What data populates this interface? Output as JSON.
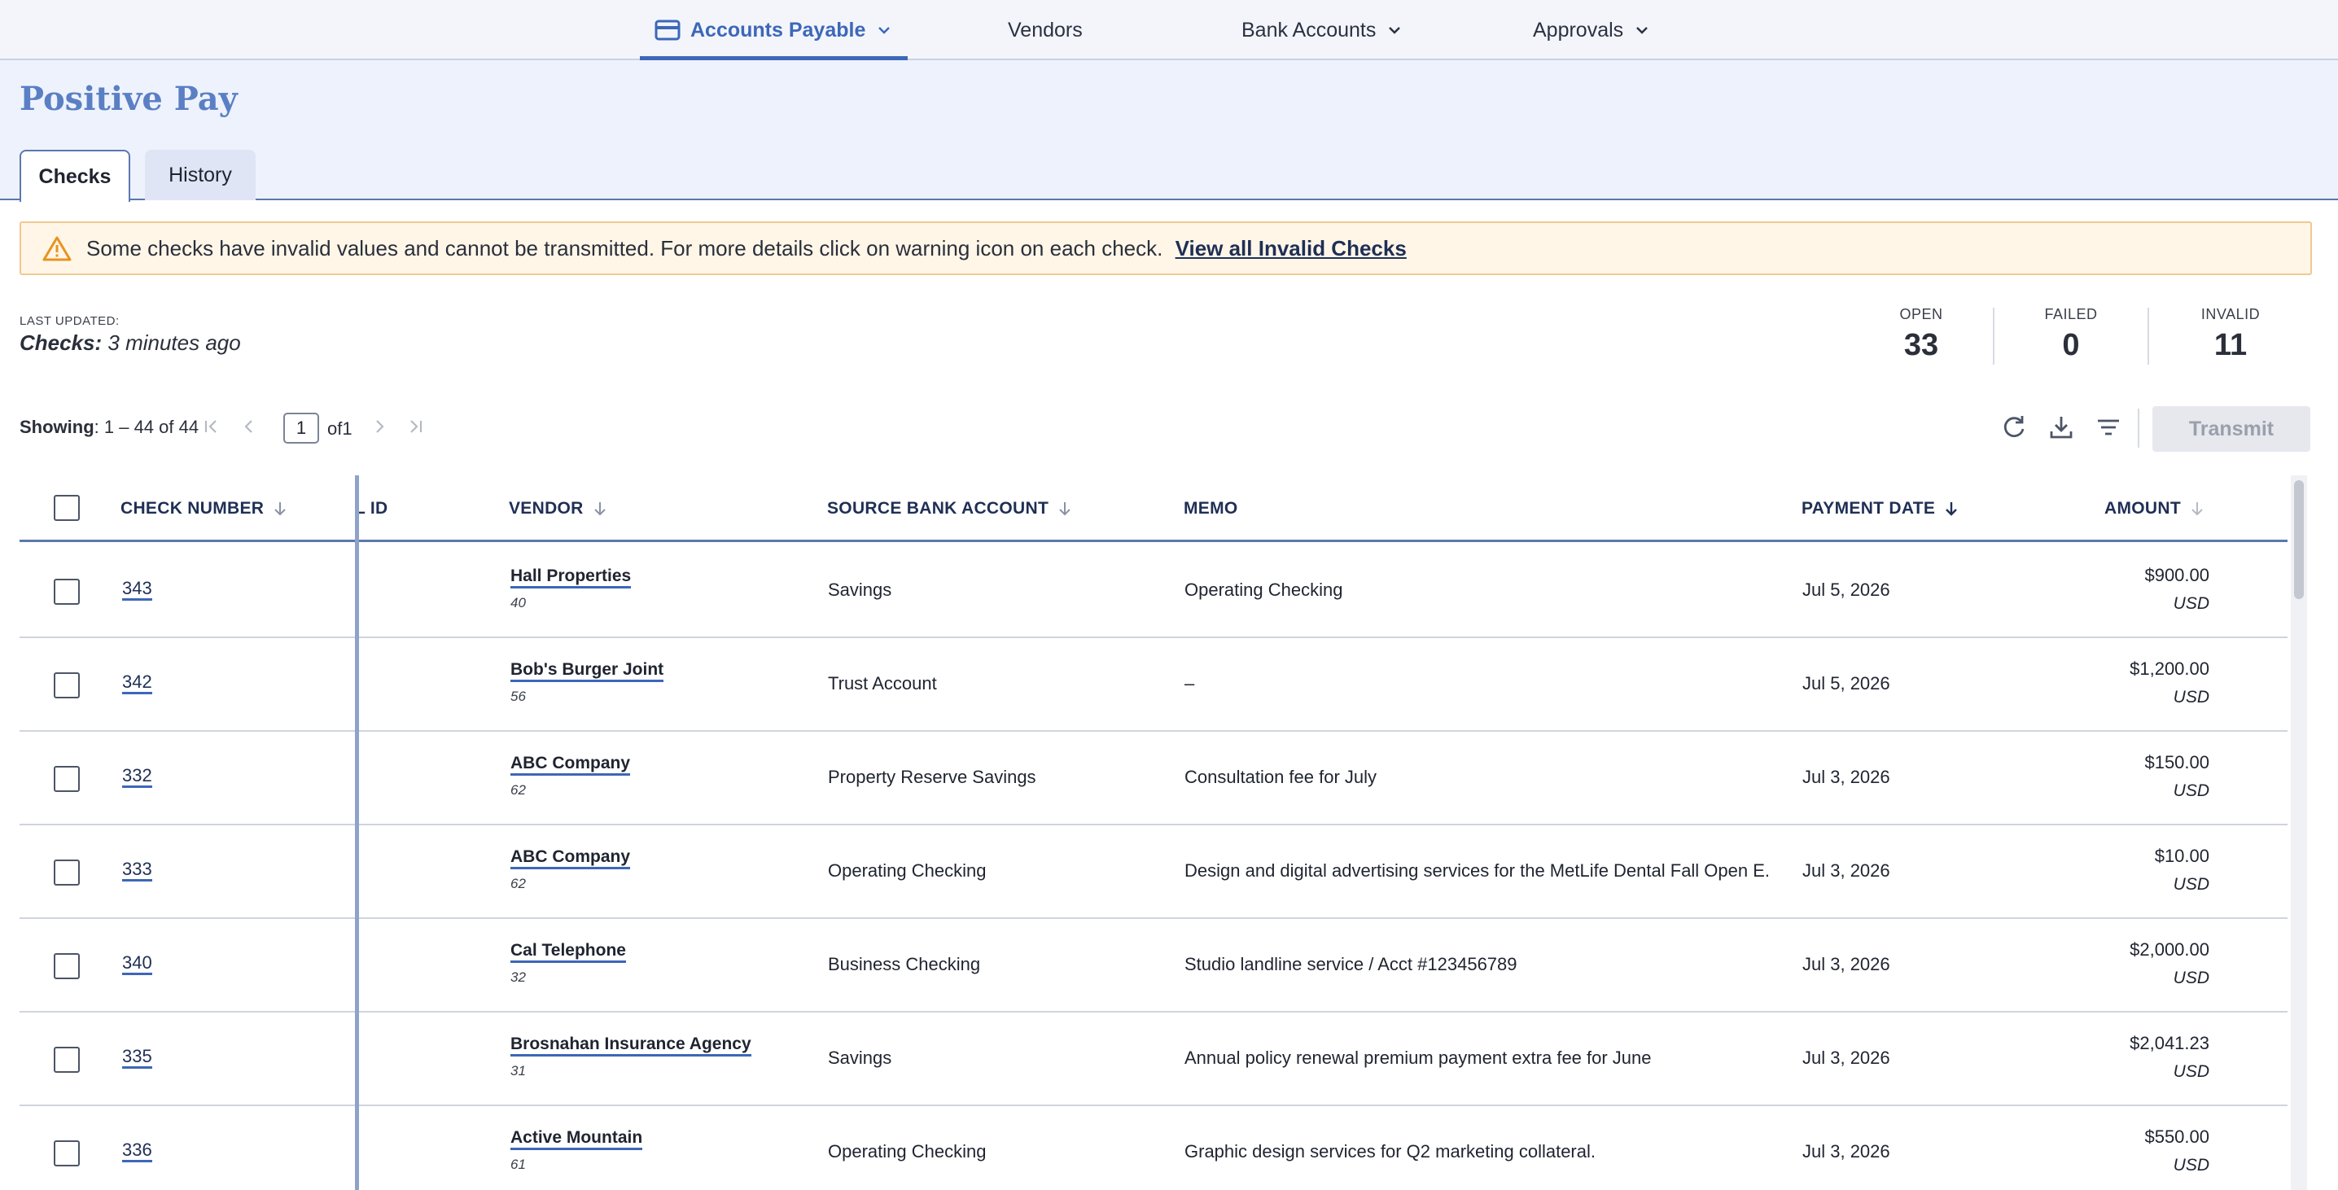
{
  "nav": {
    "items": [
      {
        "label": "Accounts Payable",
        "has_dropdown": true,
        "active": true,
        "icon": "card-icon"
      },
      {
        "label": "Vendors",
        "has_dropdown": false,
        "active": false
      },
      {
        "label": "Bank Accounts",
        "has_dropdown": true,
        "active": false
      },
      {
        "label": "Approvals",
        "has_dropdown": true,
        "active": false
      }
    ]
  },
  "page": {
    "title": "Positive Pay",
    "tabs": [
      {
        "label": "Checks",
        "active": true
      },
      {
        "label": "History",
        "active": false
      }
    ]
  },
  "banner": {
    "icon": "warning-icon",
    "message": "Some checks have invalid values and cannot be transmitted. For more details click on warning icon on each check.",
    "link": "View all Invalid Checks"
  },
  "status": {
    "last_updated_label": "LAST UPDATED:",
    "last_updated_subject": "Checks:",
    "last_updated_value": "3 minutes ago"
  },
  "stats": [
    {
      "label": "OPEN",
      "value": "33"
    },
    {
      "label": "FAILED",
      "value": "0"
    },
    {
      "label": "INVALID",
      "value": "11"
    }
  ],
  "pagination": {
    "showing_label": "Showing",
    "showing_range": ": 1 – 44 of 44",
    "page": "1",
    "of_label": "of1"
  },
  "toolbar": {
    "transmit_label": "Transmit",
    "icons": [
      "refresh-icon",
      "download-icon",
      "filter-icon"
    ]
  },
  "table": {
    "columns": {
      "check_number": "CHECK NUMBER",
      "id": "L ID",
      "vendor": "VENDOR",
      "source_bank_account": "SOURCE BANK ACCOUNT",
      "memo": "MEMO",
      "payment_date": "PAYMENT DATE",
      "amount": "AMOUNT"
    },
    "rows": [
      {
        "check": "343",
        "vendor": "Hall Properties",
        "vendor_id": "40",
        "account": "Savings",
        "memo": "Operating Checking",
        "date": "Jul 5, 2026",
        "amount": "$900.00",
        "currency": "USD"
      },
      {
        "check": "342",
        "vendor": "Bob's Burger Joint",
        "vendor_id": "56",
        "account": "Trust Account",
        "memo": "–",
        "date": "Jul 5, 2026",
        "amount": "$1,200.00",
        "currency": "USD"
      },
      {
        "check": "332",
        "vendor": "ABC Company",
        "vendor_id": "62",
        "account": "Property Reserve Savings",
        "memo": "Consultation fee for July",
        "date": "Jul 3, 2026",
        "amount": "$150.00",
        "currency": "USD"
      },
      {
        "check": "333",
        "vendor": "ABC Company",
        "vendor_id": "62",
        "account": "Operating Checking",
        "memo": "Design and digital advertising services for the MetLife Dental Fall Open E...",
        "date": "Jul 3, 2026",
        "amount": "$10.00",
        "currency": "USD"
      },
      {
        "check": "340",
        "vendor": "Cal Telephone",
        "vendor_id": "32",
        "account": "Business Checking",
        "memo": "Studio landline service / Acct #123456789",
        "date": "Jul 3, 2026",
        "amount": "$2,000.00",
        "currency": "USD"
      },
      {
        "check": "335",
        "vendor": "Brosnahan Insurance Agency",
        "vendor_id": "31",
        "account": "Savings",
        "memo": "Annual policy renewal premium payment extra fee for June",
        "date": "Jul 3, 2026",
        "amount": "$2,041.23",
        "currency": "USD"
      },
      {
        "check": "336",
        "vendor": "Active Mountain",
        "vendor_id": "61",
        "account": "Operating Checking",
        "memo": "Graphic design services for Q2 marketing collateral.",
        "date": "Jul 3, 2026",
        "amount": "$550.00",
        "currency": "USD"
      }
    ]
  },
  "colors": {
    "accent": "#3d67b8",
    "title": "#5a7fc4",
    "warning_bg": "#fff6e8",
    "warning_border": "#f0c98f",
    "warning_icon": "#e8931f"
  }
}
